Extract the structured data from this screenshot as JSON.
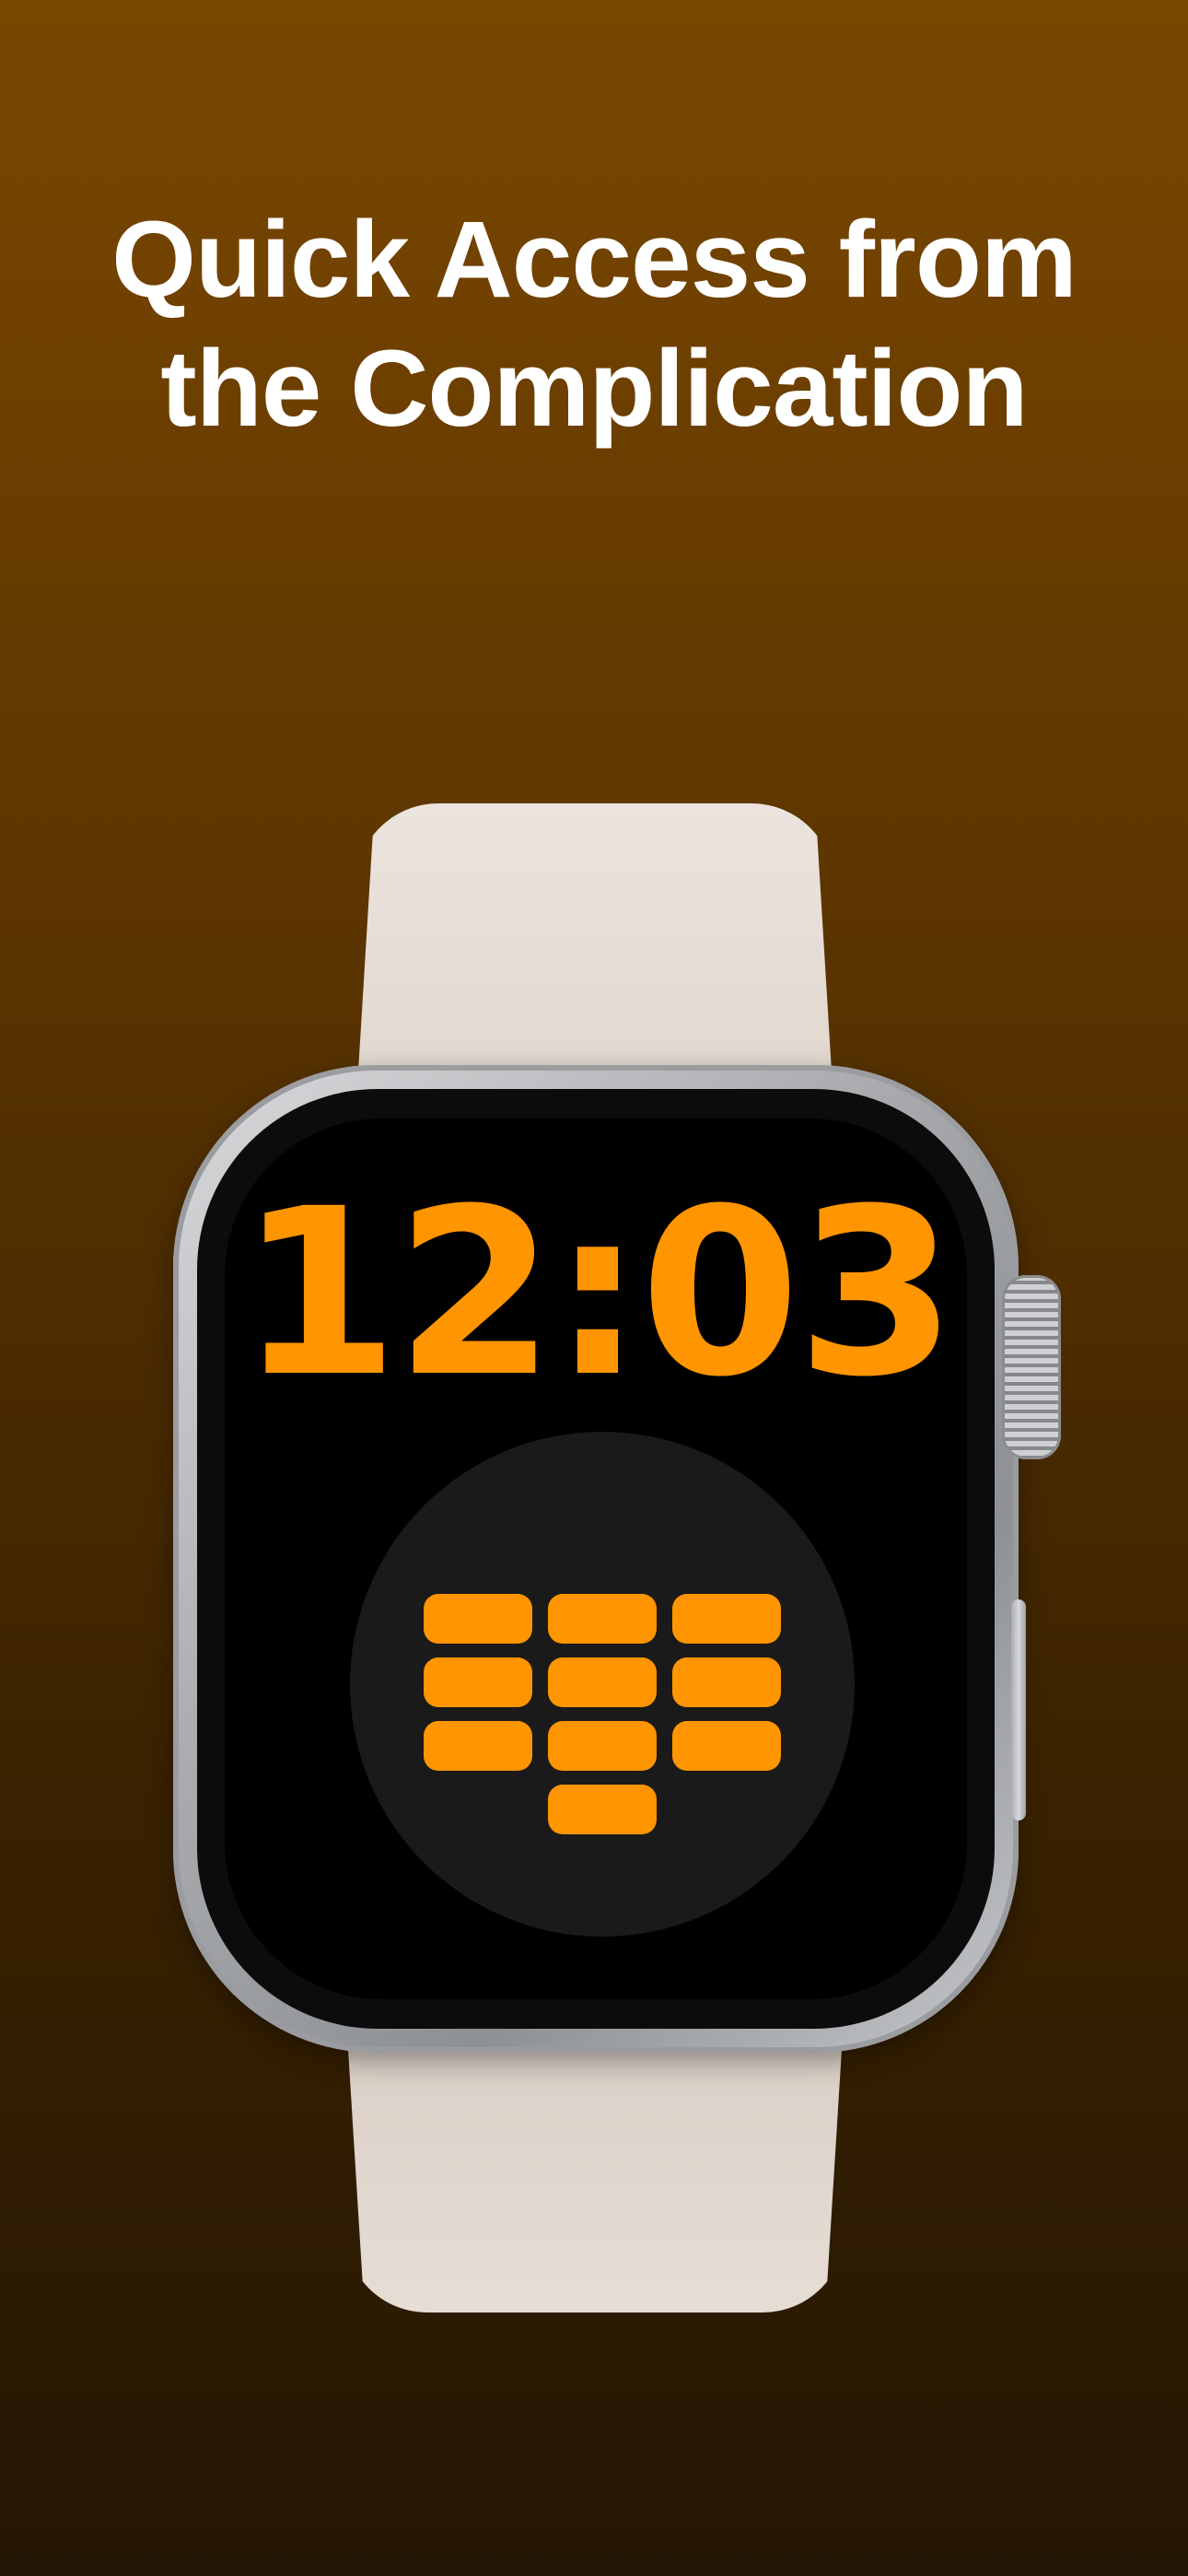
{
  "headline": {
    "line1": "Quick Access from",
    "line2": "the Complication"
  },
  "watch": {
    "time": "12:03",
    "accent_color": "#ff9500",
    "band_color": "#e6ddd5",
    "case_color": "#b9bbbe",
    "complication": {
      "icon": "keypad-icon",
      "key_rows": [
        3,
        3,
        3,
        1
      ]
    }
  }
}
